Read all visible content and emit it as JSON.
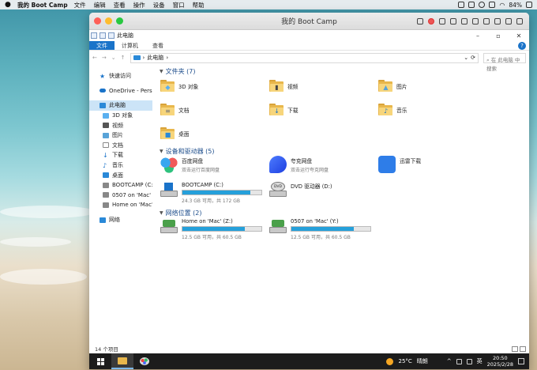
{
  "menubar": {
    "app_name": "我的 Boot Camp",
    "menus": [
      "文件",
      "编辑",
      "查看",
      "操作",
      "设备",
      "窗口",
      "帮助"
    ],
    "battery": "84%"
  },
  "parallels": {
    "title": "我的 Boot Camp"
  },
  "explorer": {
    "window_title": "此电脑",
    "ribbon_tabs": [
      "文件",
      "计算机",
      "查看"
    ],
    "address": "此电脑",
    "search_placeholder": "在 此电脑 中搜索",
    "nav": {
      "quick_access": "快速访问",
      "onedrive": "OneDrive - Perso",
      "this_pc": "此电脑",
      "sub_items": [
        "3D 对象",
        "视频",
        "图片",
        "文档",
        "下载",
        "音乐",
        "桌面"
      ],
      "drives": [
        "BOOTCAMP (C:)",
        "0507 on 'Mac' (",
        "Home on 'Mac' ("
      ],
      "network": "网络"
    },
    "folders_header": "文件夹 (7)",
    "folders": [
      "3D 对象",
      "视频",
      "图片",
      "文档",
      "下载",
      "音乐",
      "桌面"
    ],
    "devices_header": "设备和驱动器 (5)",
    "apps": [
      {
        "name": "百度网盘",
        "sub": "双击运行百度网盘"
      },
      {
        "name": "夸克网盘",
        "sub": "双击运行夸克网盘"
      },
      {
        "name": "迅雷下载",
        "sub": ""
      }
    ],
    "drives": [
      {
        "name": "BOOTCAMP (C:)",
        "space": "24.3 GB 可用，共 172 GB",
        "used_fraction": 0.86
      },
      {
        "name": "DVD 驱动器 (D:)",
        "space": "",
        "used_fraction": 0
      }
    ],
    "network_header": "网络位置 (2)",
    "network_locations": [
      {
        "name": "Home on 'Mac' (Z:)",
        "space": "12.5 GB 可用，共 60.5 GB",
        "used_fraction": 0.79
      },
      {
        "name": "0507 on 'Mac' (Y:)",
        "space": "12.5 GB 可用，共 60.5 GB",
        "used_fraction": 0.79
      }
    ],
    "status": "14 个项目"
  },
  "taskbar": {
    "weather_temp": "25°C",
    "weather_text": "晴朗",
    "ime": "英",
    "time": "20:50",
    "date": "2025/2/28"
  },
  "colors": {
    "accent": "#1a73c9",
    "bar_fill": "#26a0da",
    "selection": "#cce4f7"
  }
}
